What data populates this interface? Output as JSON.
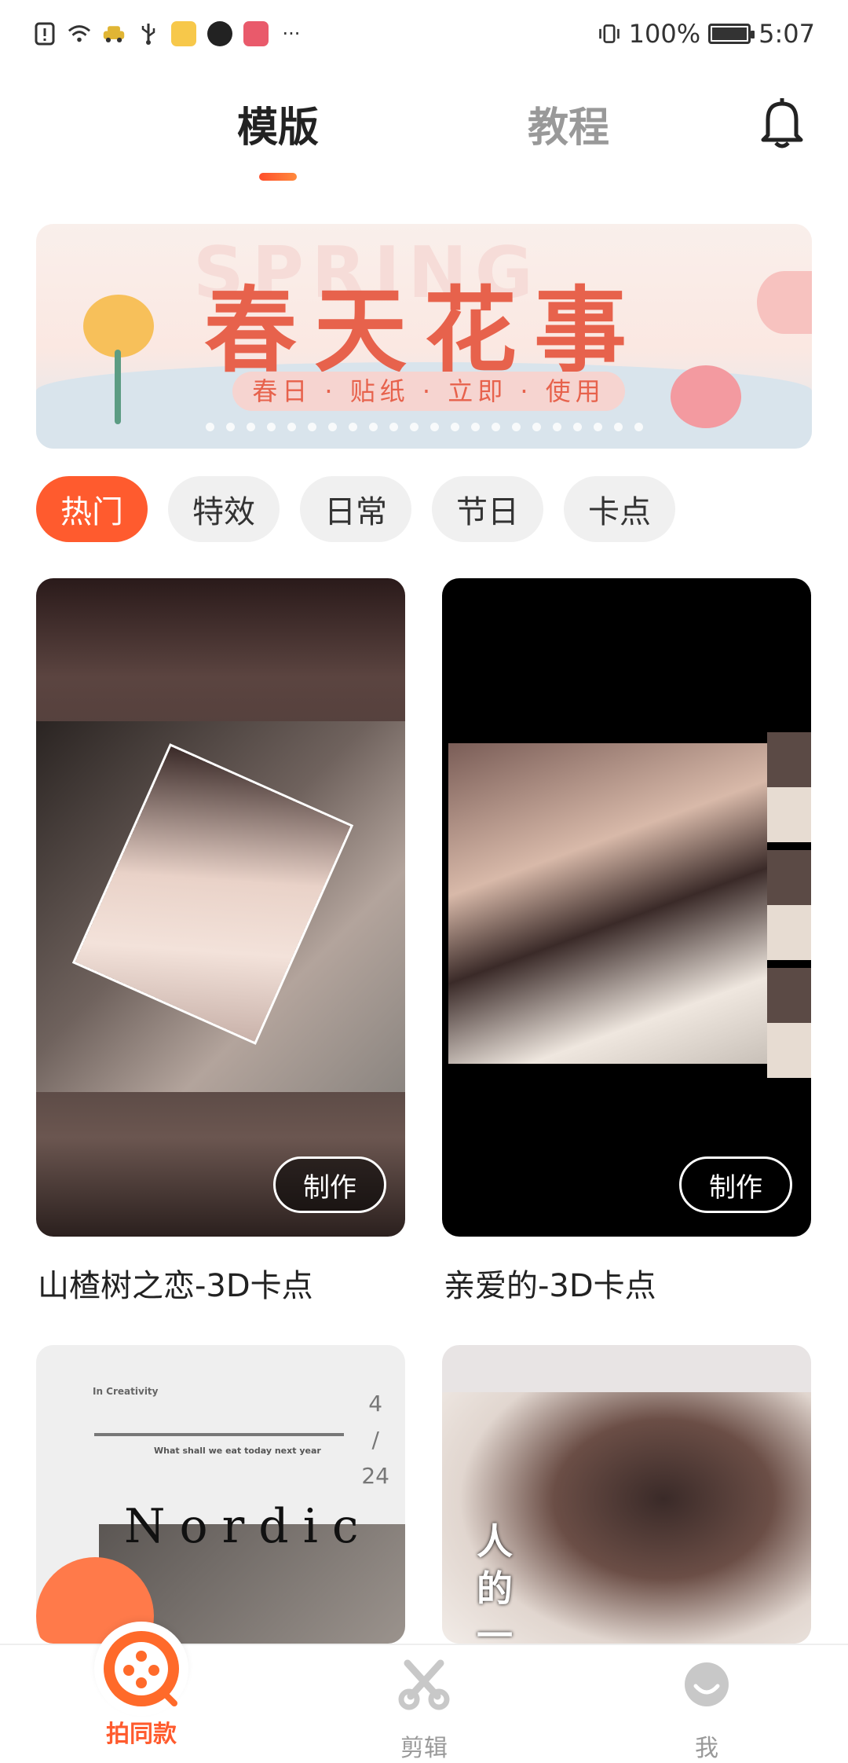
{
  "status_bar": {
    "battery": "100%",
    "time": "5:07",
    "more": "···"
  },
  "top_tabs": {
    "active": "模版",
    "inactive": "教程"
  },
  "banner": {
    "title": "春天花事",
    "subtitle": "春日 · 贴纸 · 立即 · 使用",
    "watermark": "SPRING"
  },
  "categories": [
    {
      "label": "热门",
      "active": true
    },
    {
      "label": "特效",
      "active": false
    },
    {
      "label": "日常",
      "active": false
    },
    {
      "label": "节日",
      "active": false
    },
    {
      "label": "卡点",
      "active": false
    }
  ],
  "templates": [
    {
      "title": "山楂树之恋-3D卡点",
      "button": "制作"
    },
    {
      "title": "亲爱的-3D卡点",
      "button": "制作"
    }
  ],
  "card3": {
    "small_text": "In Creativity",
    "tiny_text": "What shall we eat today next year",
    "word": "Nordic",
    "num_top": "4",
    "num_sep": "/",
    "num_bottom": "24"
  },
  "card4": {
    "text": "人的一"
  },
  "bottom_nav": [
    {
      "label": "拍同款",
      "icon": "film-reel-icon",
      "active": true
    },
    {
      "label": "剪辑",
      "icon": "scissors-icon",
      "active": false
    },
    {
      "label": "我",
      "icon": "profile-face-icon",
      "active": false
    }
  ],
  "colors": {
    "accent": "#ff5b2e",
    "inactive_text": "#999999"
  }
}
